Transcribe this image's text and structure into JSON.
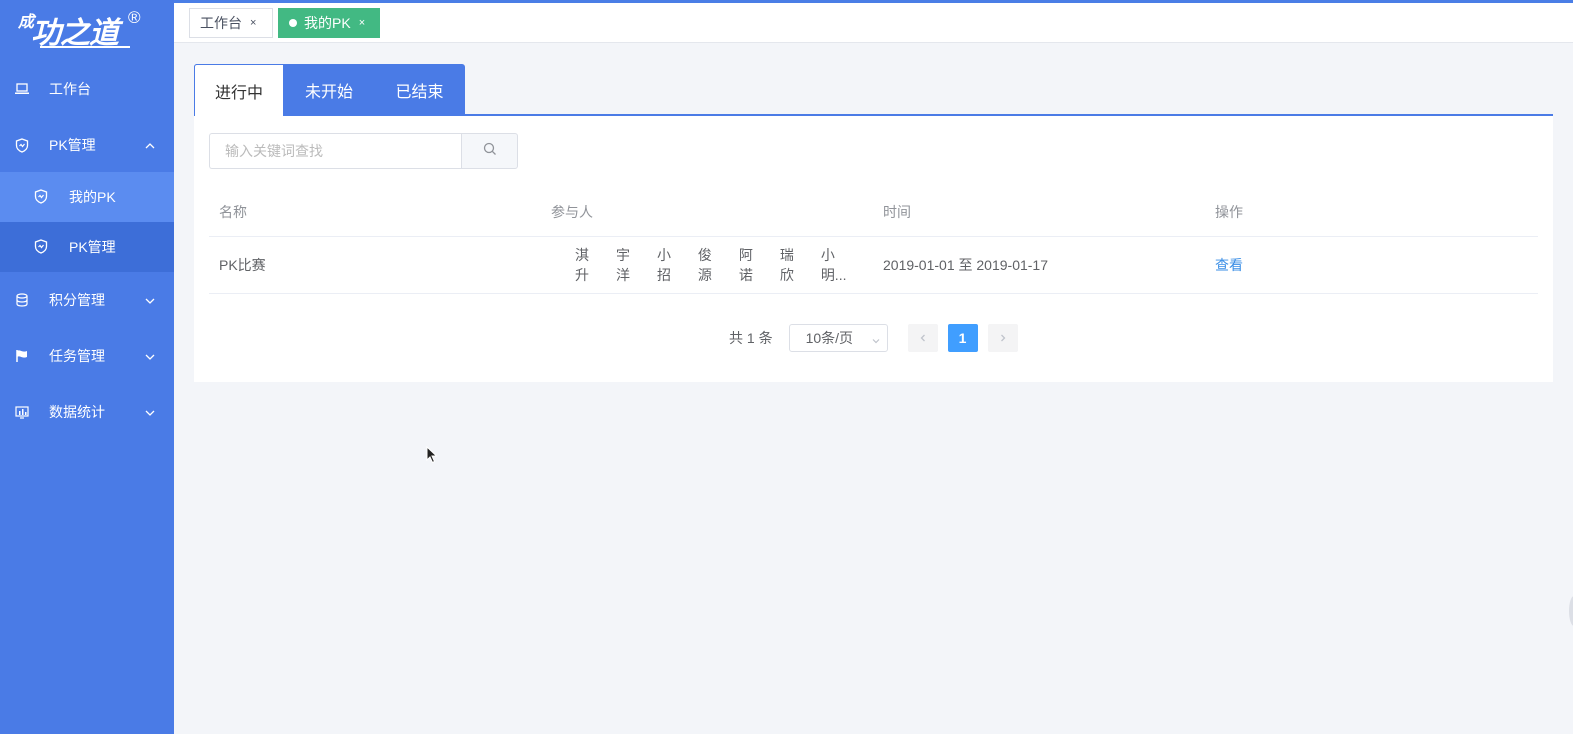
{
  "logo": {
    "small": "成",
    "main": "功之道",
    "registered": "®"
  },
  "sidebar": {
    "items": [
      {
        "label": "工作台",
        "icon": "laptop-icon"
      },
      {
        "label": "PK管理",
        "icon": "shield-icon",
        "expanded": true,
        "children": [
          {
            "label": "我的PK",
            "icon": "shield-icon",
            "active": true
          },
          {
            "label": "PK管理",
            "icon": "shield-icon",
            "active": false
          }
        ]
      },
      {
        "label": "积分管理",
        "icon": "database-icon"
      },
      {
        "label": "任务管理",
        "icon": "flag-icon"
      },
      {
        "label": "数据统计",
        "icon": "chart-icon"
      }
    ]
  },
  "page_tabs": [
    {
      "label": "工作台",
      "close": "×"
    },
    {
      "label": "我的PK",
      "close": "×",
      "active": true
    }
  ],
  "status_tabs": [
    "进行中",
    "未开始",
    "已结束"
  ],
  "search": {
    "placeholder": "输入关键词查找"
  },
  "table": {
    "headers": [
      "名称",
      "参与人",
      "时间",
      "操作"
    ],
    "rows": [
      {
        "name": "PK比赛",
        "participants": [
          "淇升",
          "宇洋",
          "小招",
          "俊源",
          "阿诺",
          "瑞欣",
          "小明..."
        ],
        "time": "2019-01-01 至 2019-01-17",
        "action": "查看"
      }
    ]
  },
  "pagination": {
    "total": "共 1 条",
    "page_size": "10条/页",
    "current": "1"
  },
  "colors": {
    "sidebar": "#4a7be6",
    "active_tab": "#42b983",
    "primary": "#409eff"
  }
}
